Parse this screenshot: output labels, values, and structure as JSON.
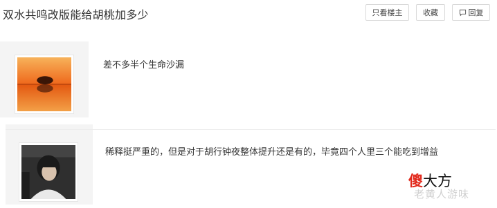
{
  "thread": {
    "title": "双水共鸣改版能给胡桃加多少"
  },
  "toolbar": {
    "only_op_label": "只看楼主",
    "favorite_label": "收藏",
    "reply_label": "回复",
    "reply_icon": "comment-icon"
  },
  "posts": [
    {
      "text": "差不多半个生命沙漏",
      "avatar": "sunset-tree-avatar"
    },
    {
      "text": "稀释挺严重的，但是对于胡行钟夜整体提升还是有的，毕竟四个人里三个能吃到增益",
      "avatar": "person-photo-avatar"
    }
  ],
  "watermark": {
    "brand_red": "傻",
    "brand_black": "大方",
    "sub": "老黄人游味"
  },
  "colors": {
    "accent_red": "#e2291c",
    "border": "#d9d9d9"
  }
}
